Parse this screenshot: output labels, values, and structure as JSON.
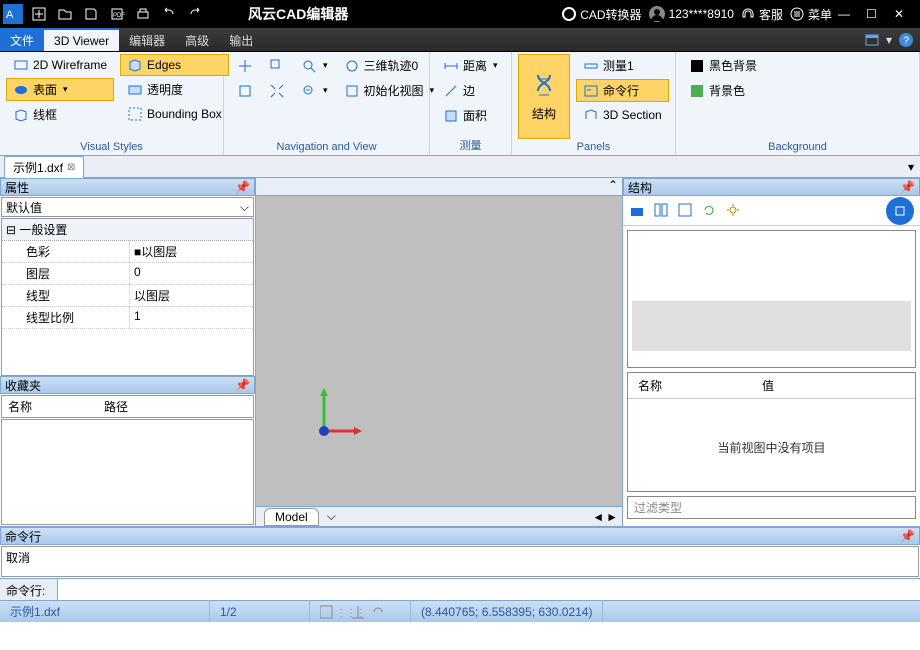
{
  "title": "风云CAD编辑器",
  "titlebar_right": {
    "converter": "CAD转换器",
    "user": "123****8910",
    "support": "客服",
    "menu": "菜单"
  },
  "menu": {
    "file": "文件",
    "viewer": "3D Viewer",
    "editor": "编辑器",
    "advanced": "高级",
    "output": "输出"
  },
  "ribbon": {
    "visual_styles": {
      "title": "Visual Styles",
      "wireframe2d": "2D Wireframe",
      "edges": "Edges",
      "surface": "表面",
      "transparency": "透明度",
      "wireframe": "线框",
      "bounding": "Bounding Box"
    },
    "nav": {
      "title": "Navigation and View",
      "orbit": "三维轨迹0",
      "initview": "初始化视图"
    },
    "measure": {
      "title": "测量",
      "distance": "距离",
      "edge": "边",
      "area": "面积"
    },
    "panels": {
      "title": "Panels",
      "structure": "结构",
      "measure1": "测量1",
      "cmdline": "命令行",
      "section3d": "3D Section"
    },
    "background": {
      "title": "Background",
      "black": "黑色背景",
      "bgcolor": "背景色"
    }
  },
  "doc_tab": "示例1.dxf",
  "props": {
    "title": "属性",
    "selector": "默认值",
    "group": "一般设置",
    "rows": [
      {
        "k": "色彩",
        "v": "■以图层"
      },
      {
        "k": "图层",
        "v": "0"
      },
      {
        "k": "线型",
        "v": "以图层"
      },
      {
        "k": "线型比例",
        "v": "1"
      }
    ]
  },
  "fav": {
    "title": "收藏夹",
    "col1": "名称",
    "col2": "路径"
  },
  "model_tab": "Model",
  "structure": {
    "title": "结构",
    "name": "名称",
    "value": "值",
    "empty": "当前视图中没有项目",
    "filter": "过滤类型"
  },
  "cmd": {
    "title": "命令行",
    "last": "取消",
    "prompt": "命令行:"
  },
  "status": {
    "file": "示例1.dxf",
    "page": "1/2",
    "coords": "(8.440765; 6.558395; 630.0214)"
  }
}
